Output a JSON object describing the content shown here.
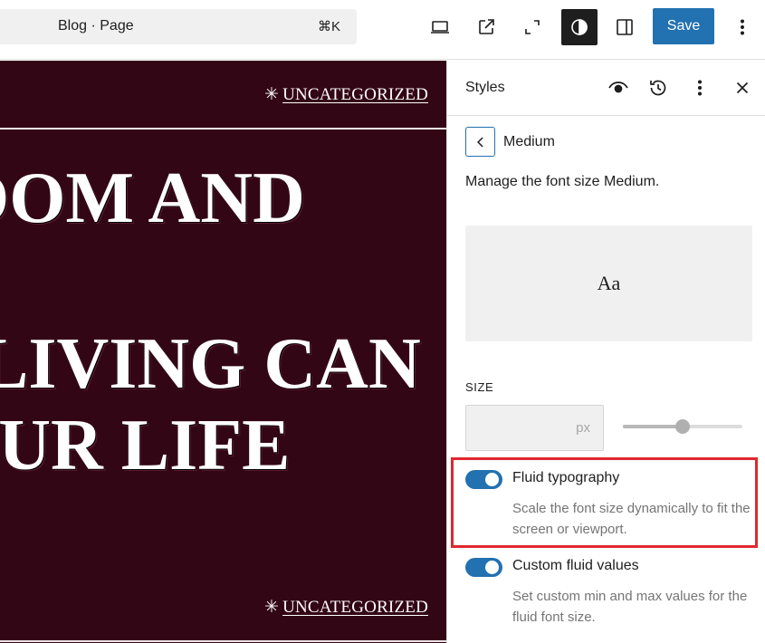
{
  "toolbar": {
    "command_title": "Blog · Page",
    "command_shortcut": "⌘K",
    "icons": [
      "desktop-preview-icon",
      "external-view-icon",
      "fullscreen-icon",
      "styles-contrast-icon",
      "sidebar-toggle-icon",
      "more-options-icon"
    ],
    "save_label": "Save",
    "accent": "#2271b1"
  },
  "canvas": {
    "background": "#330616",
    "category_top": "UNCATEGORIZED",
    "category_bottom": "UNCATEGORIZED",
    "category_prefix": "✳",
    "headline_lines": [
      "OOM AND",
      "LIVING CAN",
      "OUR LIFE"
    ]
  },
  "sidebar": {
    "title": "Styles",
    "screen_title": "Medium",
    "description": "Manage the font size Medium.",
    "preview_text": "Aa",
    "size_label": "SIZE",
    "size_value": "",
    "size_unit": "px",
    "size_slider_fraction": 0.5,
    "fluid": {
      "label": "Fluid typography",
      "help": "Scale the font size dynamically to fit the screen or viewport.",
      "enabled": true
    },
    "custom_fluid": {
      "label": "Custom fluid values",
      "help": "Set custom min and max values for the fluid font size.",
      "enabled": true
    },
    "highlight_color": "#e0282e"
  }
}
